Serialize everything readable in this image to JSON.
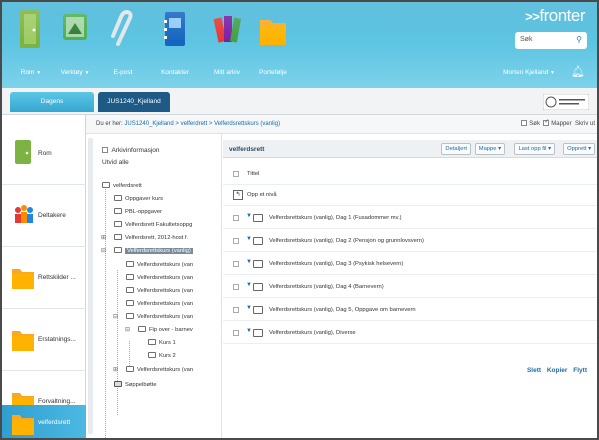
{
  "apps": [
    {
      "label": "Rom",
      "caret": "▼",
      "icon": "door-icon",
      "color": "#8bc34a"
    },
    {
      "label": "Verktøy",
      "caret": "▼",
      "icon": "tools-icon",
      "color": "#6fcf7a"
    },
    {
      "label": "E-post",
      "caret": "",
      "icon": "paperclip-icon",
      "color": "#cfd8dc"
    },
    {
      "label": "Kontakter",
      "caret": "",
      "icon": "contacts-book-icon",
      "color": "#1e6fb5"
    },
    {
      "label": "Mitt arkiv",
      "caret": "",
      "icon": "archive-icon",
      "color": "#7a4bb0"
    },
    {
      "label": "Portefølje",
      "caret": "",
      "icon": "folder-icon",
      "color": "#f7a21b"
    }
  ],
  "brand": {
    "arrows": ">>",
    "name": "fronter"
  },
  "search": {
    "placeholder": "Søk",
    "icon": "search-icon"
  },
  "user": {
    "name": "Morten Kjelland",
    "caret": "▼",
    "bell_icon": "bell-icon"
  },
  "tabs": [
    {
      "label": "Dagens"
    },
    {
      "label": "JUS1240_Kjelland"
    }
  ],
  "breadcrumb": {
    "prefix": "Du er her:",
    "path": "JUS1240_Kjelland > velferdrett > Velferdsrettskurs (vanlig)"
  },
  "view_options": {
    "sok": "Søk",
    "mapper": "Mapper",
    "skriv": "Skriv ut"
  },
  "rooms": [
    {
      "label": "Rom",
      "icon": "door-icon",
      "selected": false
    },
    {
      "label": "Deltakere",
      "icon": "participants-icon",
      "selected": false
    },
    {
      "label": "Rettskilder ...",
      "icon": "folder-icon",
      "selected": false
    },
    {
      "label": "Erstatnings...",
      "icon": "folder-icon",
      "selected": false
    },
    {
      "label": "Forvaltning...",
      "icon": "folder-icon",
      "selected": false
    },
    {
      "label": "velferdsrett",
      "icon": "folder-icon",
      "selected": true
    }
  ],
  "tree": {
    "arkivinfo": "Arkivinformasjon",
    "utvid": "Utvid alle",
    "nodes": [
      {
        "label": "velferdsrett"
      },
      {
        "label": "Oppgaver kurs"
      },
      {
        "label": "PBL-oppgaver"
      },
      {
        "label": "Velferdsrett Fakultetsoppg"
      },
      {
        "label": "Velferdsrett, 2012-host f."
      },
      {
        "label": "Velferdsrettskurs (vanlig)"
      },
      {
        "label": "Velferdsrettskurs (van"
      },
      {
        "label": "Velferdsrettskurs (van"
      },
      {
        "label": "Velferdsrettskurs (van"
      },
      {
        "label": "Velferdsrettskurs (van"
      },
      {
        "label": "Velferdsrettskurs (van"
      },
      {
        "label": "Flp over - barnev"
      },
      {
        "label": "Kurs 1"
      },
      {
        "label": "Kurs 2"
      },
      {
        "label": "Velferdsrettskurs (van"
      },
      {
        "label": "Søppelbøtte"
      }
    ]
  },
  "main": {
    "title": "velferdsrett",
    "buttons": {
      "detaljert": "Detaljert",
      "mappe": "Mappe ▾",
      "last_opp": "Last opp fil ▾",
      "opprett": "Opprett ▾"
    },
    "header": "Tittel",
    "up": "Opp et nivå",
    "rows": [
      "Velferdsrettskurs (vanlig), Dag 1 (Fusadommer mv.)",
      "Velferdsrettskurs (vanlig), Dag 2 (Pensjon og grunnlovsvern)",
      "Velferdsrettskurs (vanlig), Dag 3 (Psykisk helsevern)",
      "Velferdsrettskurs (vanlig), Dag 4 (Barnevern)",
      "Velferdsrettskurs (vanlig), Dag 5, Oppgave om barnevern",
      "Velferdsrettskurs (vanlig), Diverse"
    ],
    "actions": {
      "slett": "Slett",
      "kopier": "Kopier",
      "flytt": "Flytt"
    }
  }
}
